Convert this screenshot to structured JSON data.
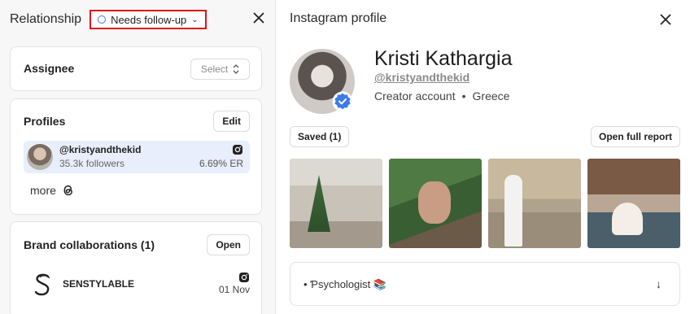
{
  "left": {
    "title": "Relationship",
    "status": "Needs follow-up",
    "assignee": {
      "label": "Assignee",
      "select_label": "Select"
    },
    "profiles": {
      "label": "Profiles",
      "edit_label": "Edit",
      "items": [
        {
          "handle": "@kristyandthekid",
          "followers": "35.3k followers",
          "er": "6.69% ER",
          "platform": "instagram-icon"
        }
      ],
      "more_label": "more"
    },
    "brand": {
      "label": "Brand collaborations (1)",
      "open_label": "Open",
      "items": [
        {
          "name": "SENSTYLABLE",
          "date": "01 Nov",
          "platform": "instagram-icon"
        }
      ]
    }
  },
  "right": {
    "title": "Instagram profile",
    "name": "Kristi Kathargia",
    "handle": "@kristyandthekid",
    "account_type": "Creator account",
    "separator": "•",
    "country": "Greece",
    "saved_label": "Saved (1)",
    "report_label": "Open full report",
    "bio": "• Ƥsychologist 📚",
    "expand_icon": "↓"
  },
  "colors": {
    "highlight_border": "#e0141c",
    "status_dot": "#4a74e0",
    "profile_row_bg": "#e8eefb",
    "verified": "#3b7bea"
  }
}
